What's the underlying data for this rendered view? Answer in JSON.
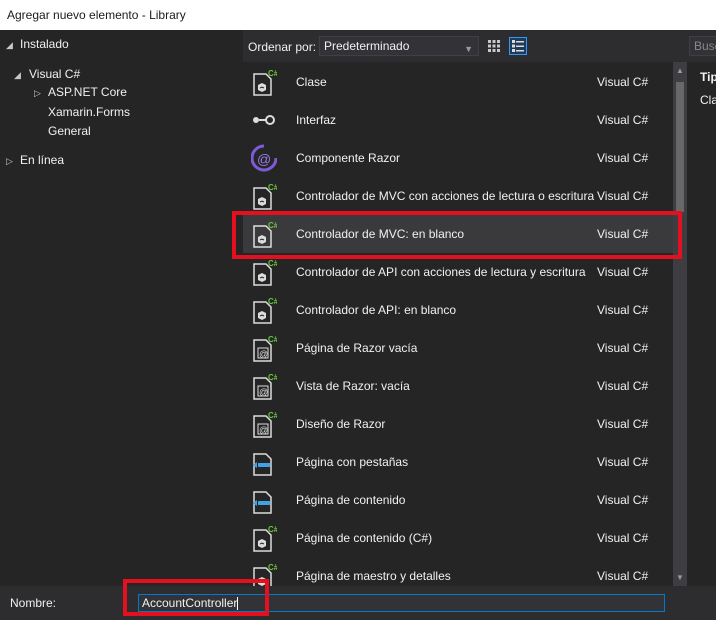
{
  "window": {
    "title": "Agregar nuevo elemento - Library"
  },
  "tree": {
    "installed": "Instalado",
    "language": "Visual C#",
    "children": [
      "ASP.NET Core",
      "Xamarin.Forms",
      "General"
    ],
    "online": "En línea"
  },
  "toolbar": {
    "sort_label": "Ordenar por:",
    "sort_value": "Predeterminado",
    "search_placeholder": "Busc"
  },
  "items": [
    {
      "name": "Clase",
      "lang": "Visual C#",
      "icon": "class-icon"
    },
    {
      "name": "Interfaz",
      "lang": "Visual C#",
      "icon": "interface-icon"
    },
    {
      "name": "Componente Razor",
      "lang": "Visual C#",
      "icon": "razor-component-icon"
    },
    {
      "name": "Controlador de MVC con acciones de lectura o escritura",
      "lang": "Visual C#",
      "icon": "controller-icon"
    },
    {
      "name": "Controlador de MVC: en blanco",
      "lang": "Visual C#",
      "icon": "controller-icon"
    },
    {
      "name": "Controlador de API con acciones de lectura y escritura",
      "lang": "Visual C#",
      "icon": "controller-icon"
    },
    {
      "name": "Controlador de API: en blanco",
      "lang": "Visual C#",
      "icon": "controller-icon"
    },
    {
      "name": "Página de Razor vacía",
      "lang": "Visual C#",
      "icon": "razor-page-icon"
    },
    {
      "name": "Vista de Razor: vacía",
      "lang": "Visual C#",
      "icon": "razor-page-icon"
    },
    {
      "name": "Diseño de Razor",
      "lang": "Visual C#",
      "icon": "razor-layout-icon"
    },
    {
      "name": "Página con pestañas",
      "lang": "Visual C#",
      "icon": "xaml-page-icon"
    },
    {
      "name": "Página de contenido",
      "lang": "Visual C#",
      "icon": "xaml-page-icon"
    },
    {
      "name": "Página de contenido (C#)",
      "lang": "Visual C#",
      "icon": "csharp-page-icon"
    },
    {
      "name": "Página de maestro y detalles",
      "lang": "Visual C#",
      "icon": "csharp-page-icon"
    }
  ],
  "selected_item": "Controlador de MVC: en blanco",
  "details": {
    "type_label": "Tip",
    "description": "Cla (el inc no"
  },
  "bottom": {
    "name_label": "Nombre:",
    "name_value": "AccountController"
  },
  "colors": {
    "accent": "#007acc",
    "highlight": "#e3101f",
    "csharp_badge": "#6cc644"
  }
}
